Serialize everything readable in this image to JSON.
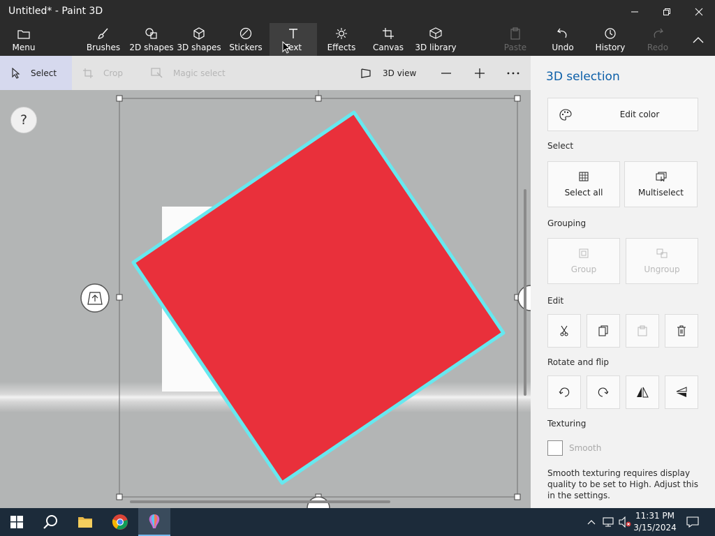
{
  "window": {
    "title": "Untitled* - Paint 3D"
  },
  "ribbon": {
    "menu": "Menu",
    "brushes": "Brushes",
    "shapes2d": "2D shapes",
    "shapes3d": "3D shapes",
    "stickers": "Stickers",
    "text": "Text",
    "effects": "Effects",
    "canvas": "Canvas",
    "library3d": "3D library",
    "paste": "Paste",
    "undo": "Undo",
    "history": "History",
    "redo": "Redo"
  },
  "toolbar": {
    "select": "Select",
    "crop": "Crop",
    "magic_select": "Magic select",
    "view3d": "3D view"
  },
  "canvas": {
    "help": "?",
    "shape_color": "#e9303b",
    "outline_color": "#67e8ef"
  },
  "panel": {
    "title": "3D selection",
    "edit_color": "Edit color",
    "select_section": "Select",
    "select_all": "Select all",
    "multiselect": "Multiselect",
    "grouping_section": "Grouping",
    "group": "Group",
    "ungroup": "Ungroup",
    "edit_section": "Edit",
    "rotate_section": "Rotate and flip",
    "texturing_section": "Texturing",
    "smooth": "Smooth",
    "smooth_note": "Smooth texturing requires display quality to be set to High. Adjust this in the settings."
  },
  "taskbar": {
    "time": "11:31 PM",
    "date": "3/15/2024"
  }
}
